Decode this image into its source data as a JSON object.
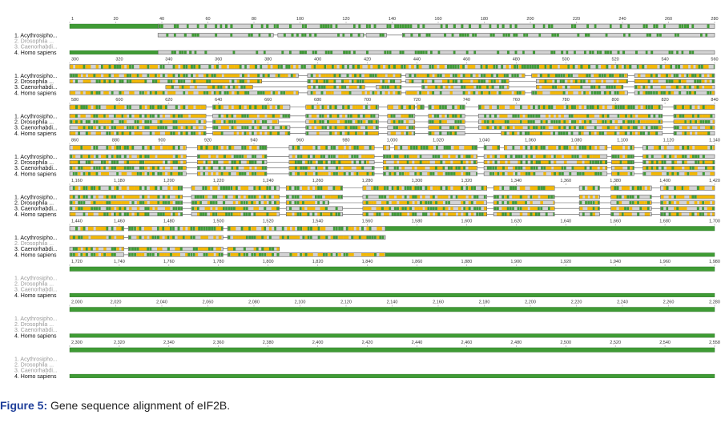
{
  "caption": {
    "label": "Figure 5:",
    "text": "Gene sequence alignment of eIF2B."
  },
  "colors": {
    "identical": "#3f9b35",
    "similar": "#f2b705",
    "gap_box": "#d3d3d3",
    "line": "#555555",
    "label_active": "#111111",
    "label_inactive": "#9a9a9a"
  },
  "sequences": [
    "1. Acythrosipho...",
    "2. Drosophila ...",
    "3. Caenorhabdi...",
    "4. Homo sapiens"
  ],
  "alignment_length": 2558,
  "blocks": [
    {
      "ticks": [
        "1",
        "20",
        "40",
        "60",
        "80",
        "100",
        "120",
        "140",
        "160",
        "180",
        "200",
        "220",
        "240",
        "260",
        "280"
      ],
      "labels_active": [
        true,
        false,
        false,
        true
      ],
      "consensus": [
        [
          1,
          40,
          "solid"
        ],
        [
          40,
          286,
          "mixed"
        ]
      ],
      "rows": [
        [
          [
            40,
            91
          ],
          [
            93,
            131
          ],
          [
            132,
            141
          ],
          [
            148,
            286
          ]
        ],
        [],
        [],
        [
          [
            1,
            40,
            "solid"
          ],
          [
            40,
            286
          ]
        ]
      ]
    },
    {
      "ticks": [
        "300",
        "320",
        "340",
        "360",
        "380",
        "400",
        "420",
        "440",
        "460",
        "480",
        "500",
        "520",
        "540",
        "560"
      ],
      "labels_active": [
        true,
        true,
        true,
        true
      ],
      "consensus": [
        [
          286,
          568,
          "mixed"
        ]
      ],
      "rows": [
        [
          [
            286,
            386
          ],
          [
            390,
            431
          ],
          [
            433,
            485
          ],
          [
            488,
            530
          ],
          [
            533,
            568
          ]
        ],
        [
          [
            286,
            370
          ],
          [
            390,
            431
          ],
          [
            433,
            478
          ],
          [
            490,
            530
          ],
          [
            533,
            568
          ]
        ],
        [
          [
            328,
            366
          ],
          [
            390,
            415
          ],
          [
            420,
            431
          ],
          [
            440,
            478
          ],
          [
            490,
            528
          ],
          [
            533,
            568
          ]
        ],
        [
          [
            286,
            386
          ],
          [
            390,
            431
          ],
          [
            433,
            485
          ],
          [
            488,
            530
          ],
          [
            533,
            568
          ]
        ]
      ]
    },
    {
      "ticks": [
        "580",
        "600",
        "620",
        "640",
        "660",
        "680",
        "700",
        "720",
        "740",
        "760",
        "780",
        "800",
        "820",
        "840"
      ],
      "labels_active": [
        true,
        true,
        true,
        true
      ],
      "consensus": [
        [
          568,
          628,
          "mixed"
        ],
        [
          631,
          665,
          "mixed"
        ],
        [
          672,
          704,
          "mixed"
        ],
        [
          708,
          720,
          "mixed"
        ],
        [
          721,
          724,
          "mixed"
        ],
        [
          726,
          742,
          "mixed"
        ],
        [
          748,
          829,
          "mixed"
        ],
        [
          834,
          852,
          "mixed"
        ]
      ],
      "rows": [
        [
          [
            568,
            628
          ],
          [
            631,
            665
          ],
          [
            672,
            704
          ],
          [
            708,
            720
          ],
          [
            726,
            742
          ],
          [
            748,
            829
          ],
          [
            834,
            852
          ]
        ],
        [
          [
            568,
            628
          ],
          [
            631,
            660
          ],
          [
            672,
            704
          ],
          [
            708,
            720
          ],
          [
            726,
            742
          ],
          [
            748,
            829
          ],
          [
            834,
            852
          ]
        ],
        [
          [
            568,
            628
          ],
          [
            631,
            665
          ],
          [
            672,
            704
          ],
          [
            708,
            720
          ],
          [
            726,
            742
          ],
          [
            748,
            829
          ],
          [
            834,
            852
          ]
        ],
        [
          [
            568,
            628
          ],
          [
            631,
            665
          ],
          [
            672,
            704
          ],
          [
            708,
            720
          ],
          [
            726,
            742
          ],
          [
            758,
            829
          ],
          [
            834,
            852
          ]
        ]
      ]
    },
    {
      "ticks": [
        "860",
        "880",
        "900",
        "920",
        "940",
        "960",
        "980",
        "1,000",
        "1,020",
        "1,040",
        "1,060",
        "1,080",
        "1,100",
        "1,120",
        "1,140"
      ],
      "labels_active": [
        true,
        true,
        true,
        true
      ],
      "consensus": [
        [
          852,
          904,
          "mixed"
        ],
        [
          909,
          940,
          "mixed"
        ],
        [
          950,
          988,
          "mixed"
        ],
        [
          992,
          995,
          "mixed"
        ],
        [
          997,
          1034,
          "mixed"
        ],
        [
          1037,
          1044,
          "mixed"
        ],
        [
          1046,
          1092,
          "mixed"
        ],
        [
          1094,
          1104,
          "mixed"
        ],
        [
          1108,
          1140,
          "mixed"
        ]
      ],
      "rows": [
        [
          [
            852,
            904
          ],
          [
            909,
            940
          ],
          [
            950,
            988
          ],
          [
            992,
            1034
          ],
          [
            1037,
            1092
          ],
          [
            1094,
            1104
          ],
          [
            1108,
            1140
          ]
        ],
        [
          [
            852,
            904
          ],
          [
            909,
            940
          ],
          [
            950,
            988
          ],
          [
            992,
            1034
          ],
          [
            1037,
            1092
          ],
          [
            1094,
            1104
          ],
          [
            1108,
            1140
          ]
        ],
        [
          [
            852,
            904
          ],
          [
            909,
            940
          ],
          [
            950,
            988
          ],
          [
            992,
            1034
          ],
          [
            1037,
            1092
          ],
          [
            1094,
            1104
          ],
          [
            1108,
            1140
          ]
        ],
        [
          [
            852,
            904
          ],
          [
            909,
            940
          ],
          [
            950,
            988
          ],
          [
            992,
            1034
          ],
          [
            1037,
            1092
          ],
          [
            1094,
            1104
          ],
          [
            1108,
            1140
          ]
        ]
      ]
    },
    {
      "ticks": [
        "1,160",
        "1,180",
        "1,200",
        "1,220",
        "1,240",
        "1,260",
        "1,280",
        "1,300",
        "1,320",
        "1,340",
        "1,360",
        "1,380",
        "1,400",
        "1,420"
      ],
      "labels_active": [
        true,
        true,
        true,
        true
      ],
      "consensus": [
        [
          1140,
          1190,
          "mixed"
        ],
        [
          1194,
          1233,
          "mixed"
        ],
        [
          1236,
          1261,
          "mixed"
        ],
        [
          1270,
          1325,
          "mixed"
        ],
        [
          1328,
          1355,
          "mixed"
        ],
        [
          1366,
          1375,
          "mixed"
        ],
        [
          1380,
          1398,
          "mixed"
        ],
        [
          1402,
          1426,
          "mixed"
        ]
      ],
      "rows": [
        [
          [
            1140,
            1190
          ],
          [
            1194,
            1233
          ],
          [
            1236,
            1261
          ],
          [
            1270,
            1325
          ],
          [
            1328,
            1355
          ],
          [
            1366,
            1375
          ],
          [
            1380,
            1398
          ],
          [
            1402,
            1426
          ]
        ],
        [
          [
            1140,
            1190
          ],
          [
            1194,
            1233
          ],
          [
            1236,
            1255
          ],
          [
            1270,
            1325
          ],
          [
            1328,
            1355
          ],
          [
            1366,
            1375
          ],
          [
            1380,
            1398
          ],
          [
            1402,
            1426
          ]
        ],
        [
          [
            1140,
            1190
          ],
          [
            1194,
            1233
          ],
          [
            1236,
            1261
          ],
          [
            1270,
            1325
          ],
          [
            1328,
            1355
          ],
          [
            1366,
            1375
          ],
          [
            1380,
            1398
          ],
          [
            1402,
            1426
          ]
        ],
        [
          [
            1140,
            1190
          ],
          [
            1194,
            1233
          ],
          [
            1236,
            1261
          ],
          [
            1270,
            1325
          ],
          [
            1328,
            1355
          ],
          [
            1366,
            1375
          ],
          [
            1380,
            1398
          ],
          [
            1402,
            1426
          ]
        ]
      ]
    },
    {
      "ticks": [
        "1,440",
        "1,460",
        "1,480",
        "1,500",
        "1,520",
        "1,540",
        "1,560",
        "1,580",
        "1,600",
        "1,620",
        "1,640",
        "1,660",
        "1,680",
        "1,700"
      ],
      "labels_active": [
        true,
        false,
        true,
        true
      ],
      "consensus": [
        [
          1426,
          1450,
          "mixed"
        ],
        [
          1452,
          1494,
          "mixed"
        ],
        [
          1496,
          1566,
          "mixed"
        ],
        [
          1566,
          1712,
          "solid"
        ]
      ],
      "rows": [
        [
          [
            1426,
            1450
          ],
          [
            1452,
            1494
          ],
          [
            1496,
            1566
          ]
        ],
        [],
        [
          [
            1426,
            1450
          ],
          [
            1452,
            1494
          ],
          [
            1496,
            1519
          ]
        ],
        [
          [
            1426,
            1450
          ],
          [
            1452,
            1494
          ],
          [
            1496,
            1566
          ],
          [
            1566,
            1712,
            "solid"
          ]
        ]
      ]
    },
    {
      "ticks": [
        "1,720",
        "1,740",
        "1,760",
        "1,780",
        "1,800",
        "1,820",
        "1,840",
        "1,860",
        "1,880",
        "1,900",
        "1,920",
        "1,940",
        "1,960",
        "1,980"
      ],
      "labels_active": [
        false,
        false,
        false,
        true
      ],
      "consensus": [
        [
          1712,
          1998,
          "solid"
        ]
      ],
      "rows": [
        [],
        [],
        [],
        [
          [
            1712,
            1998,
            "solid"
          ]
        ]
      ]
    },
    {
      "ticks": [
        "2,000",
        "2,020",
        "2,040",
        "2,060",
        "2,080",
        "2,100",
        "2,120",
        "2,140",
        "2,160",
        "2,180",
        "2,200",
        "2,220",
        "2,240",
        "2,260",
        "2,280"
      ],
      "labels_active": [
        false,
        false,
        false,
        true
      ],
      "consensus": [
        [
          1998,
          2284,
          "solid"
        ]
      ],
      "rows": [
        [],
        [],
        [],
        [
          [
            1998,
            2284,
            "solid"
          ]
        ]
      ]
    },
    {
      "ticks": [
        "2,300",
        "2,320",
        "2,340",
        "2,360",
        "2,380",
        "2,400",
        "2,420",
        "2,440",
        "2,460",
        "2,480",
        "2,500",
        "2,520",
        "2,540",
        "2,558"
      ],
      "labels_active": [
        false,
        false,
        false,
        true
      ],
      "consensus": [
        [
          2284,
          2558,
          "solid"
        ]
      ],
      "rows": [
        [],
        [],
        [],
        [
          [
            2284,
            2558,
            "solid"
          ]
        ]
      ]
    }
  ]
}
